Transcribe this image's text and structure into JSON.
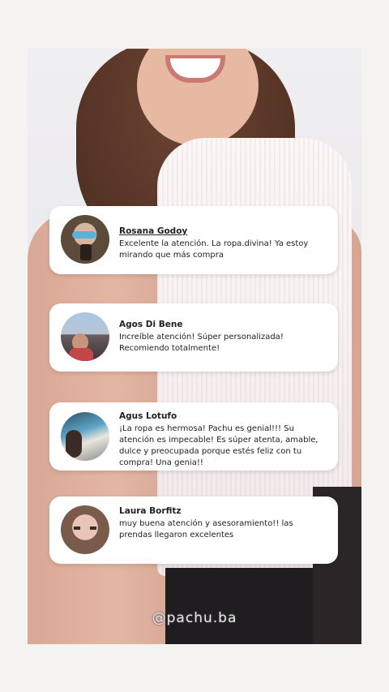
{
  "reviews": [
    {
      "name": "Rosana Godoy",
      "text": "Excelente la atención. La ropa.divina! Ya estoy mirando que más compra"
    },
    {
      "name": "Agos Di Bene",
      "text": "Increíble atención! Súper personalizada! Recomiendo totalmente!"
    },
    {
      "name": "Agus Lotufo",
      "text": "¡La ropa es hermosa! Pachu es genial!!! Su atención es impecable! Es súper atenta, amable, dulce y preocupada porque estés feliz con tu compra! Una genia!!"
    },
    {
      "name": "Laura Borfitz",
      "text": "muy buena atención y asesoramiento!! las prendas llegaron excelentes"
    }
  ],
  "handle": "@pachu.ba"
}
